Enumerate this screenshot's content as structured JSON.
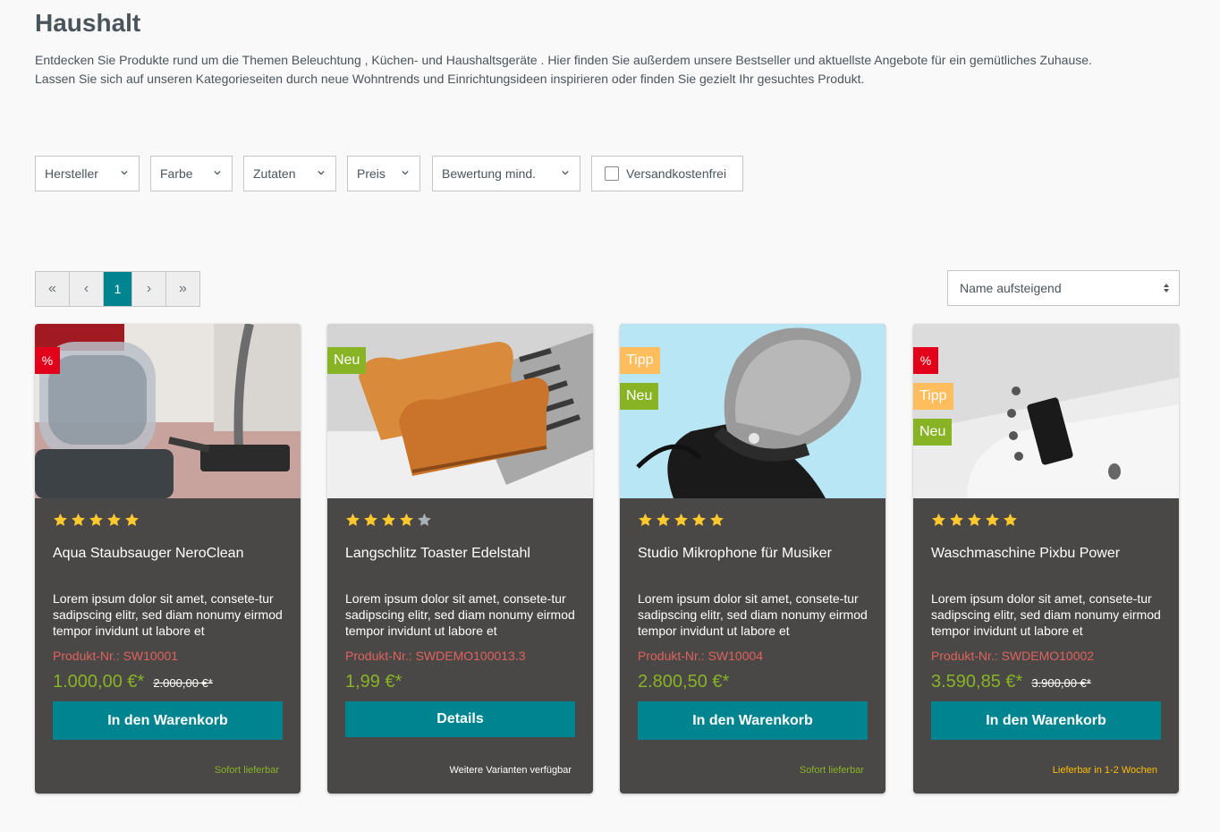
{
  "page": {
    "title": "Haushalt",
    "intro_line1": "Entdecken Sie Produkte rund um die Themen Beleuchtung , Küchen- und Haushaltsgeräte . Hier finden Sie außerdem unsere Bestseller und aktuellste Angebote für ein gemütliches Zuhause.",
    "intro_line2": "Lassen Sie sich auf unseren Kategorieseiten durch neue Wohntrends und Einrichtungsideen inspirieren oder finden Sie gezielt Ihr gesuchtes Produkt."
  },
  "filters": {
    "manufacturer": "Hersteller",
    "color": "Farbe",
    "ingredients": "Zutaten",
    "price": "Preis",
    "rating": "Bewertung mind.",
    "free_shipping": "Versandkostenfrei"
  },
  "pagination": {
    "first": "«",
    "prev": "‹",
    "current": "1",
    "next": "›",
    "last": "»"
  },
  "sorting": {
    "selected": "Name aufsteigend"
  },
  "colors": {
    "accent": "#008490",
    "price": "#88b324",
    "sku": "#e0625c",
    "sale_badge": "#e3001b",
    "new_badge": "#88b324",
    "tip_badge": "#ffbd5d",
    "card_bg": "#4a4847",
    "delivery_available": "#88b324",
    "delivery_later": "#ffbd00"
  },
  "products": [
    {
      "name": "Aqua Staubsauger NeroClean",
      "description": "Lorem ipsum dolor sit amet, consete-tur sadipscing elitr, sed diam nonumy eirmod tempor invidunt ut labore et",
      "sku": "Produkt-Nr.: SW10001",
      "price": "1.000,00 €*",
      "old_price": "2.000,00 €*",
      "rating": 5,
      "badges": [
        "%"
      ],
      "button": "In den Warenkorb",
      "delivery": "Sofort lieferbar",
      "image_icon": "vacuum-cleaner"
    },
    {
      "name": "Langschlitz Toaster Edelstahl",
      "description": "Lorem ipsum dolor sit amet, consete-tur sadipscing elitr, sed diam nonumy eirmod tempor invidunt ut labore et",
      "sku": "Produkt-Nr.: SWDEMO100013.3",
      "price": "1,99 €*",
      "old_price": "",
      "rating": 4,
      "badges": [
        "Neu"
      ],
      "button": "Details",
      "delivery": "Weitere Varianten verfügbar",
      "image_icon": "toaster"
    },
    {
      "name": "Studio Mikrophone für Musiker",
      "description": "Lorem ipsum dolor sit amet, consete-tur sadipscing elitr, sed diam nonumy eirmod tempor invidunt ut labore et",
      "sku": "Produkt-Nr.: SW10004",
      "price": "2.800,50 €*",
      "old_price": "",
      "rating": 5,
      "badges": [
        "Tipp",
        "Neu"
      ],
      "button": "In den Warenkorb",
      "delivery": "Sofort lieferbar",
      "image_icon": "microphone"
    },
    {
      "name": "Waschmaschine Pixbu Power",
      "description": "Lorem ipsum dolor sit amet, consete-tur sadipscing elitr, sed diam nonumy eirmod tempor invidunt ut labore et",
      "sku": "Produkt-Nr.: SWDEMO10002",
      "price": "3.590,85 €*",
      "old_price": "3.900,00 €*",
      "rating": 5,
      "badges": [
        "%",
        "Tipp",
        "Neu"
      ],
      "button": "In den Warenkorb",
      "delivery": "Lieferbar in 1-2 Wochen",
      "image_icon": "washing-machine"
    }
  ]
}
